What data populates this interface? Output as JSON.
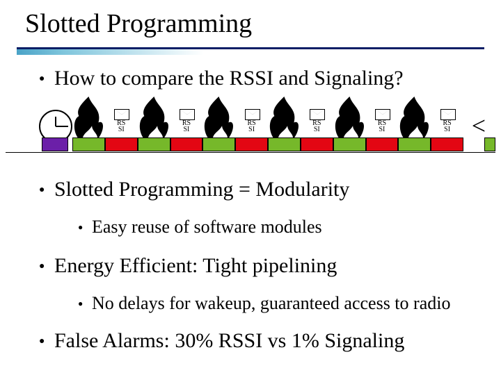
{
  "title": "Slotted Programming",
  "bullets": {
    "b1": "How to compare the RSSI and Signaling?",
    "b2": "Slotted Programming = Modularity",
    "b3": "Energy Efficient: Tight pipelining",
    "b4": "False Alarms: 30% RSSI vs 1% Signaling"
  },
  "subs": {
    "s2": "Easy reuse of software modules",
    "s3": "No delays for wakeup, guaranteed access to radio"
  },
  "timeline": {
    "rssi_label": "RSSI",
    "chevron": "<"
  }
}
